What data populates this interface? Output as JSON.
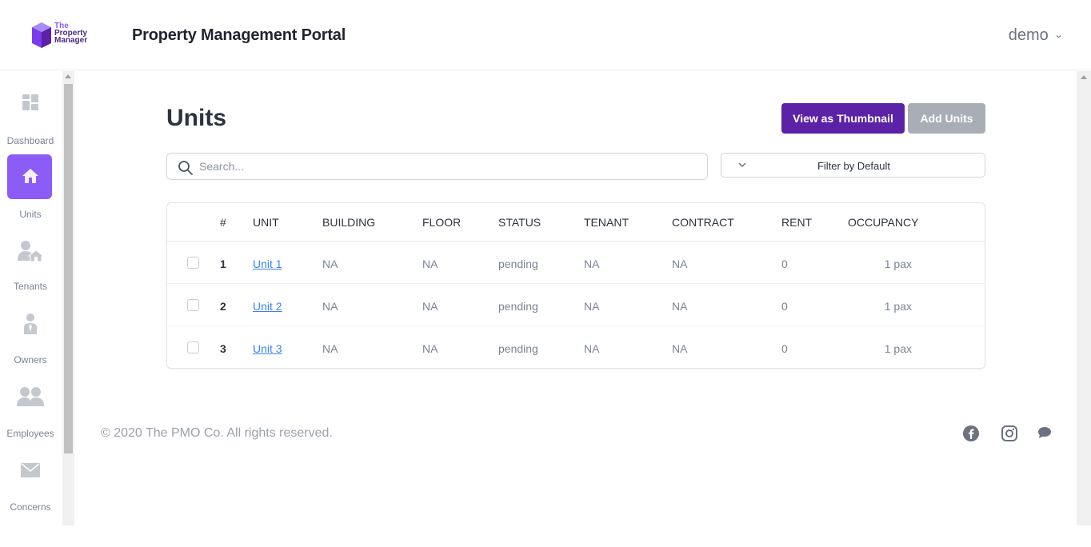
{
  "header": {
    "logo": {
      "line1": "The",
      "line2": "Property",
      "line3": "Manager"
    },
    "title": "Property Management Portal",
    "user": "demo"
  },
  "sidebar": {
    "items": [
      {
        "label": "Dashboard",
        "icon": "dashboard-icon"
      },
      {
        "label": "Units",
        "icon": "home-icon",
        "active": true
      },
      {
        "label": "Tenants",
        "icon": "tenant-icon"
      },
      {
        "label": "Owners",
        "icon": "owner-icon"
      },
      {
        "label": "Employees",
        "icon": "employees-icon"
      },
      {
        "label": "Concerns",
        "icon": "mail-icon"
      }
    ]
  },
  "main": {
    "title": "Units",
    "buttons": {
      "thumbnail": "View as Thumbnail",
      "add": "Add Units"
    },
    "search": {
      "placeholder": "Search...",
      "value": ""
    },
    "filter": {
      "label": "Filter by Default"
    },
    "table": {
      "headers": [
        "#",
        "UNIT",
        "BUILDING",
        "FLOOR",
        "STATUS",
        "TENANT",
        "CONTRACT",
        "RENT",
        "OCCUPANCY"
      ],
      "rows": [
        {
          "num": "1",
          "unit": "Unit 1",
          "building": "NA",
          "floor": "NA",
          "status": "pending",
          "tenant": "NA",
          "contract": "NA",
          "rent": "0",
          "occupancy": "1 pax"
        },
        {
          "num": "2",
          "unit": "Unit 2",
          "building": "NA",
          "floor": "NA",
          "status": "pending",
          "tenant": "NA",
          "contract": "NA",
          "rent": "0",
          "occupancy": "1 pax"
        },
        {
          "num": "3",
          "unit": "Unit 3",
          "building": "NA",
          "floor": "NA",
          "status": "pending",
          "tenant": "NA",
          "contract": "NA",
          "rent": "0",
          "occupancy": "1 pax"
        }
      ]
    }
  },
  "footer": {
    "copyright": "© 2020 The PMO Co. All rights reserved.",
    "social": [
      "facebook-icon",
      "instagram-icon",
      "chat-icon"
    ]
  },
  "colors": {
    "primary": "#5b21a6",
    "accent": "#8b5cf6",
    "disabled": "#a9adb5",
    "link": "#3b82f6"
  }
}
